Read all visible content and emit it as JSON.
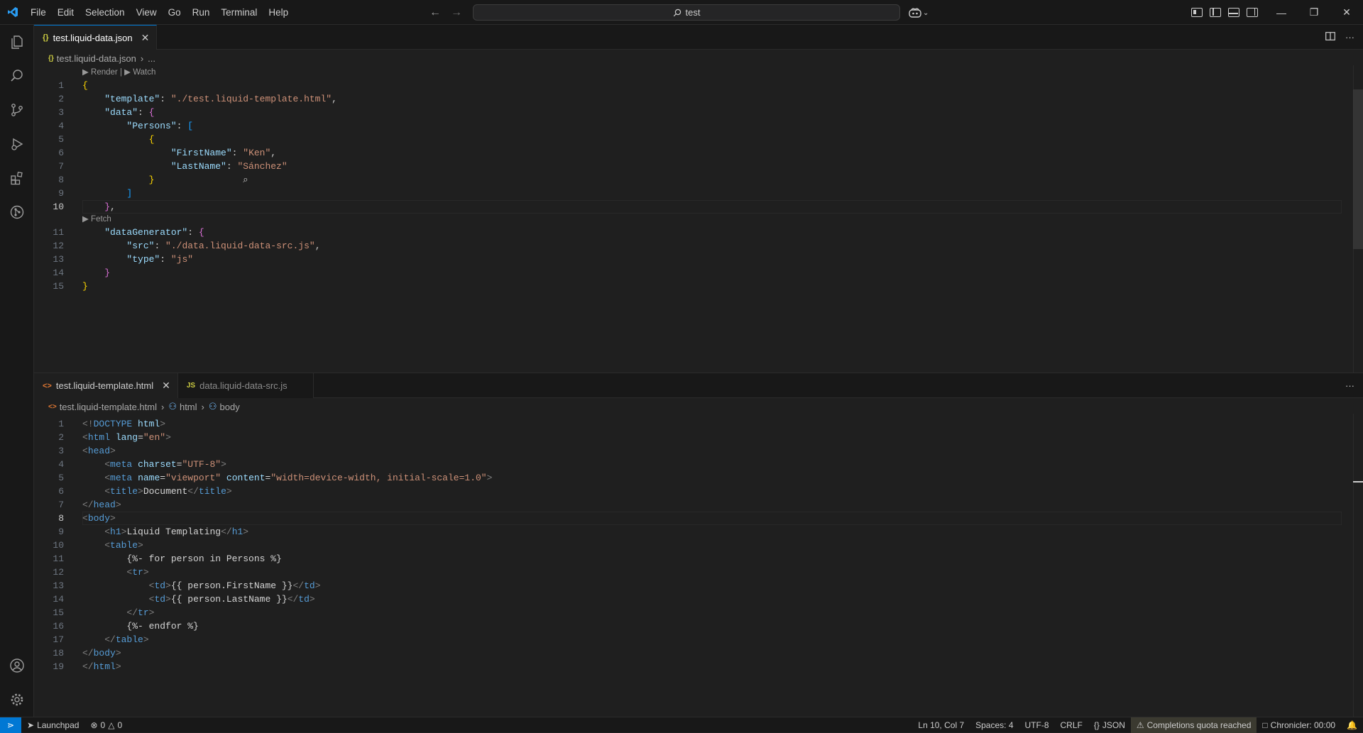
{
  "menu": [
    "File",
    "Edit",
    "Selection",
    "View",
    "Go",
    "Run",
    "Terminal",
    "Help"
  ],
  "search": {
    "text": "test"
  },
  "top_group": {
    "tab": {
      "icon": "{}",
      "label": "test.liquid-data.json"
    },
    "breadcrumb": {
      "file": "test.liquid-data.json",
      "rest": "..."
    },
    "lens_render": "Render",
    "lens_watch": "Watch",
    "lens_fetch": "Fetch",
    "line_numbers": [
      "1",
      "2",
      "3",
      "4",
      "5",
      "6",
      "7",
      "8",
      "9",
      "10",
      "11",
      "12",
      "13",
      "14",
      "15"
    ],
    "current_line": "10"
  },
  "bottom_group": {
    "tabs": [
      {
        "icon": "<>",
        "label": "test.liquid-template.html"
      },
      {
        "icon": "JS",
        "label": "data.liquid-data-src.js"
      }
    ],
    "breadcrumb": {
      "file": "test.liquid-template.html",
      "html": "html",
      "body": "body"
    },
    "line_numbers": [
      "1",
      "2",
      "3",
      "4",
      "5",
      "6",
      "7",
      "8",
      "9",
      "10",
      "11",
      "12",
      "13",
      "14",
      "15",
      "16",
      "17",
      "18",
      "19"
    ],
    "current_line": "8"
  },
  "statusbar": {
    "launchpad": "Launchpad",
    "errors": "0",
    "warnings": "0",
    "position": "Ln 10, Col 7",
    "spaces": "Spaces: 4",
    "encoding": "UTF-8",
    "eol": "CRLF",
    "language": "JSON",
    "completions": "Completions quota reached",
    "chronicler": "Chronicler: 00:00"
  },
  "colors": {
    "accent": "#0078d4",
    "background": "#1f1f1f",
    "chrome": "#181818"
  }
}
